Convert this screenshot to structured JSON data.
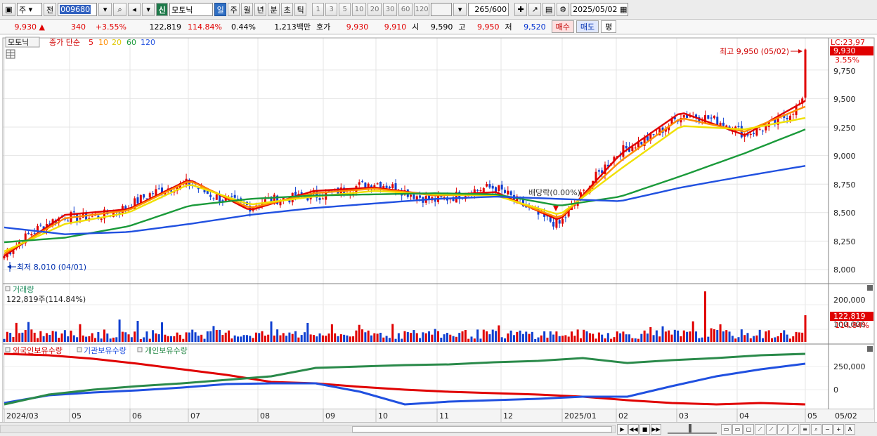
{
  "toolbar": {
    "market_label": "주",
    "prev_label": "전",
    "stock_code": "009680",
    "new_badge": "신",
    "stock_name": "모토닉",
    "periods": [
      "일",
      "주",
      "월",
      "년",
      "분",
      "초",
      "틱"
    ],
    "selected_period": "일",
    "intervals": [
      "1",
      "3",
      "5",
      "10",
      "20",
      "30",
      "60",
      "120"
    ],
    "count": "265",
    "count_max": "/600",
    "date": "2025/05/02"
  },
  "quote": {
    "price": "9,930",
    "arrow": "▲",
    "change": "340",
    "change_pct": "+3.55%",
    "volume": "122,819",
    "volume_ratio": "114.84%",
    "turnover": "0.44%",
    "amount": "1,213백만",
    "ask_label": "호가",
    "ask1": "9,930",
    "ask2": "9,910",
    "open_label": "시",
    "open": "9,590",
    "high_label": "고",
    "high": "9,950",
    "low_label": "저",
    "low": "9,520",
    "buy_label": "매수",
    "sell_label": "매도",
    "eval_label": "평"
  },
  "chart": {
    "legend_name": "모토닉",
    "legend_main": "종가 단순",
    "ma_labels": [
      "5",
      "10",
      "20",
      "60",
      "120"
    ],
    "ma_colors": [
      "#e00000",
      "#ff8c00",
      "#f0e000",
      "#1a9a3a",
      "#2050e0"
    ],
    "lc_label": "LC:23,97",
    "price_tag": "9,930",
    "price_tag_pct": "3.55%",
    "price_axis": [
      "9,750",
      "9,500",
      "9,250",
      "9,000",
      "8,750",
      "8,500",
      "8,250",
      "8,000"
    ],
    "high_note": "최고 9,950 (05/02)",
    "low_note": "최저 8,010 (04/01)",
    "mid_note": "배당락(0.00%)",
    "volume_title": "거래량",
    "volume_value": "122,819주(114.84%)",
    "volume_axis": [
      "200,000",
      "100,000"
    ],
    "volume_tag": "122,819",
    "volume_tag_pct": "114.84%",
    "holders_legend": [
      "외국인보유수량",
      "기관보유수량",
      "개인보유수량"
    ],
    "holders_axis": [
      "250,000",
      "0"
    ],
    "x_labels": [
      "2024/03",
      "05",
      "06",
      "07",
      "08",
      "09",
      "10",
      "11",
      "12",
      "2025/01",
      "02",
      "03",
      "04",
      "05"
    ],
    "x_last_label": "05/02",
    "colors": {
      "up": "#e00000",
      "down": "#1040d0",
      "foreign": "#e00000",
      "inst": "#2050e0",
      "retail": "#2a8a4a"
    }
  },
  "chart_data": {
    "type": "line",
    "title": "",
    "price_range": [
      7900,
      10000
    ],
    "price_ticks": [
      8000,
      8250,
      8500,
      8750,
      9000,
      9250,
      9500,
      9750
    ],
    "x": [
      "2024/03",
      "2024/05",
      "2024/06",
      "2024/07",
      "2024/08",
      "2024/09",
      "2024/10",
      "2024/11",
      "2024/12",
      "2025/01",
      "2025/02",
      "2025/03",
      "2025/04",
      "2025/05"
    ],
    "series": [
      {
        "name": "5",
        "values": [
          8120,
          8480,
          8530,
          8790,
          8520,
          8690,
          8720,
          8650,
          8680,
          8430,
          9010,
          9380,
          9180,
          9480
        ]
      },
      {
        "name": "10",
        "values": [
          8140,
          8450,
          8520,
          8780,
          8540,
          8670,
          8710,
          8650,
          8660,
          8450,
          8950,
          9330,
          9210,
          9430
        ]
      },
      {
        "name": "20",
        "values": [
          8160,
          8400,
          8500,
          8750,
          8570,
          8640,
          8690,
          8660,
          8650,
          8480,
          8880,
          9260,
          9230,
          9330
        ]
      },
      {
        "name": "60",
        "values": [
          8240,
          8280,
          8380,
          8560,
          8620,
          8650,
          8660,
          8670,
          8660,
          8560,
          8640,
          8820,
          9020,
          9230
        ]
      },
      {
        "name": "120",
        "values": [
          8370,
          8310,
          8330,
          8400,
          8480,
          8540,
          8580,
          8620,
          8640,
          8620,
          8600,
          8720,
          8820,
          8910
        ]
      }
    ]
  }
}
